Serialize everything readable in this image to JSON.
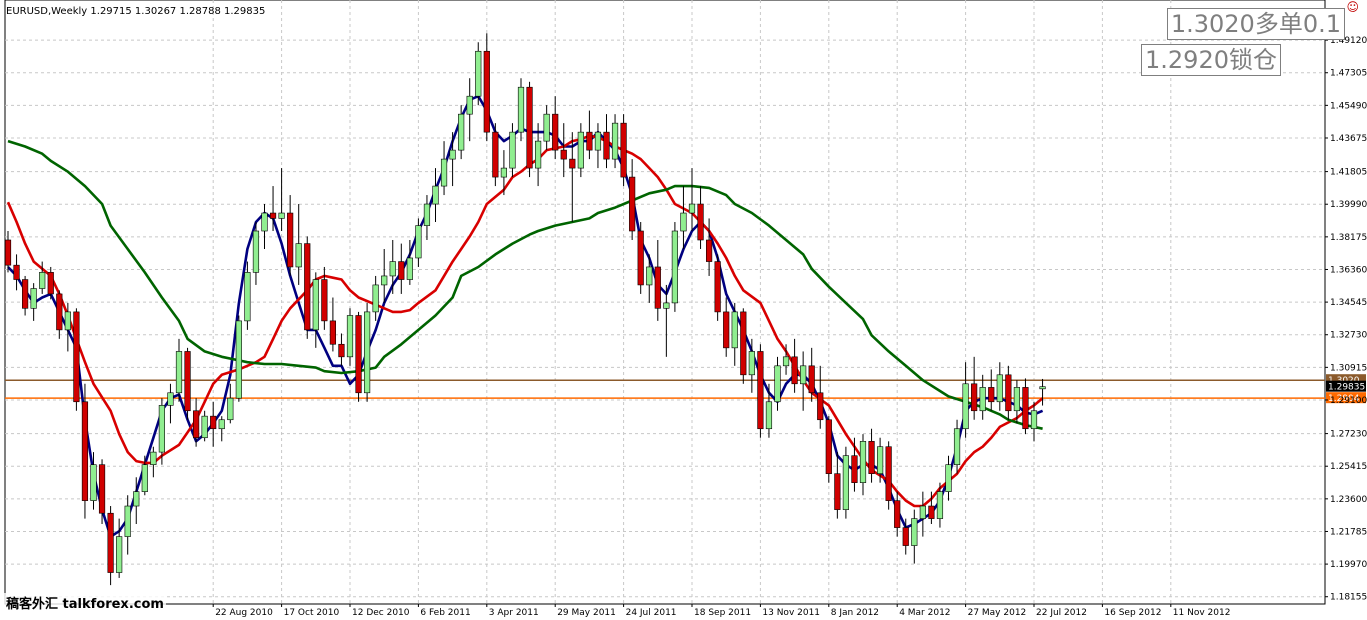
{
  "chart_data": {
    "type": "candlestick",
    "title": "EURUSD,Weekly  1.29715 1.30267 1.28788 1.29835",
    "symbol": "EURUSD",
    "timeframe": "Weekly",
    "ohlc_readout": [
      1.29715,
      1.30267,
      1.28788,
      1.29835
    ],
    "ylim": [
      1.1775,
      1.5035
    ],
    "y_ticks": [
      "1.49120",
      "1.47305",
      "1.45490",
      "1.43675",
      "1.41805",
      "1.39990",
      "1.38175",
      "1.36360",
      "1.34545",
      "1.32730",
      "1.30915",
      "1.29100",
      "1.27230",
      "1.25415",
      "1.23600",
      "1.21785",
      "1.19970",
      "1.18155"
    ],
    "x_tick_labels": [
      "22 Aug 2010",
      "17 Oct 2010",
      "12 Dec 2010",
      "6 Feb 2011",
      "3 Apr 2011",
      "29 May 2011",
      "24 Jul 2011",
      "18 Sep 2011",
      "13 Nov 2011",
      "8 Jan 2012",
      "4 Mar 2012",
      "27 May 2012",
      "22 Jul 2012",
      "16 Sep 2012",
      "11 Nov 2012"
    ],
    "x_tick_index": [
      24,
      32,
      40,
      48,
      56,
      64,
      72,
      80,
      88,
      96,
      104,
      112,
      120,
      128,
      136
    ],
    "grid": true,
    "bull_color": "#90ee90",
    "bear_color": "#d00000",
    "candles": [
      [
        1.38,
        1.385,
        1.362,
        1.366
      ],
      [
        1.366,
        1.372,
        1.352,
        1.358
      ],
      [
        1.358,
        1.36,
        1.338,
        1.342
      ],
      [
        1.342,
        1.356,
        1.335,
        1.353
      ],
      [
        1.353,
        1.368,
        1.35,
        1.362
      ],
      [
        1.362,
        1.365,
        1.347,
        1.35
      ],
      [
        1.35,
        1.352,
        1.325,
        1.33
      ],
      [
        1.33,
        1.345,
        1.318,
        1.34
      ],
      [
        1.34,
        1.342,
        1.285,
        1.29
      ],
      [
        1.29,
        1.3,
        1.225,
        1.235
      ],
      [
        1.235,
        1.262,
        1.23,
        1.255
      ],
      [
        1.255,
        1.258,
        1.222,
        1.228
      ],
      [
        1.228,
        1.232,
        1.188,
        1.195
      ],
      [
        1.195,
        1.225,
        1.192,
        1.215
      ],
      [
        1.215,
        1.238,
        1.205,
        1.232
      ],
      [
        1.232,
        1.248,
        1.222,
        1.24
      ],
      [
        1.24,
        1.26,
        1.238,
        1.255
      ],
      [
        1.255,
        1.265,
        1.248,
        1.262
      ],
      [
        1.262,
        1.292,
        1.255,
        1.288
      ],
      [
        1.288,
        1.3,
        1.278,
        1.295
      ],
      [
        1.295,
        1.325,
        1.29,
        1.318
      ],
      [
        1.318,
        1.32,
        1.28,
        1.285
      ],
      [
        1.285,
        1.292,
        1.265,
        1.27
      ],
      [
        1.27,
        1.285,
        1.268,
        1.282
      ],
      [
        1.282,
        1.29,
        1.265,
        1.275
      ],
      [
        1.275,
        1.282,
        1.268,
        1.28
      ],
      [
        1.28,
        1.3,
        1.278,
        1.292
      ],
      [
        1.292,
        1.338,
        1.29,
        1.335
      ],
      [
        1.335,
        1.368,
        1.33,
        1.362
      ],
      [
        1.362,
        1.39,
        1.355,
        1.385
      ],
      [
        1.385,
        1.4,
        1.375,
        1.395
      ],
      [
        1.395,
        1.41,
        1.385,
        1.392
      ],
      [
        1.392,
        1.42,
        1.385,
        1.395
      ],
      [
        1.395,
        1.405,
        1.36,
        1.365
      ],
      [
        1.365,
        1.4,
        1.355,
        1.378
      ],
      [
        1.378,
        1.382,
        1.325,
        1.33
      ],
      [
        1.33,
        1.362,
        1.32,
        1.358
      ],
      [
        1.358,
        1.365,
        1.33,
        1.335
      ],
      [
        1.335,
        1.348,
        1.318,
        1.322
      ],
      [
        1.322,
        1.328,
        1.31,
        1.315
      ],
      [
        1.315,
        1.342,
        1.31,
        1.338
      ],
      [
        1.338,
        1.34,
        1.29,
        1.295
      ],
      [
        1.295,
        1.345,
        1.29,
        1.34
      ],
      [
        1.34,
        1.36,
        1.335,
        1.355
      ],
      [
        1.355,
        1.375,
        1.345,
        1.36
      ],
      [
        1.36,
        1.38,
        1.35,
        1.368
      ],
      [
        1.368,
        1.378,
        1.35,
        1.358
      ],
      [
        1.358,
        1.38,
        1.355,
        1.37
      ],
      [
        1.37,
        1.392,
        1.365,
        1.388
      ],
      [
        1.388,
        1.405,
        1.38,
        1.4
      ],
      [
        1.4,
        1.42,
        1.39,
        1.41
      ],
      [
        1.41,
        1.435,
        1.405,
        1.425
      ],
      [
        1.425,
        1.44,
        1.41,
        1.43
      ],
      [
        1.43,
        1.455,
        1.425,
        1.45
      ],
      [
        1.45,
        1.47,
        1.435,
        1.46
      ],
      [
        1.46,
        1.49,
        1.455,
        1.485
      ],
      [
        1.485,
        1.495,
        1.435,
        1.44
      ],
      [
        1.44,
        1.445,
        1.41,
        1.415
      ],
      [
        1.415,
        1.43,
        1.405,
        1.42
      ],
      [
        1.42,
        1.445,
        1.415,
        1.44
      ],
      [
        1.44,
        1.47,
        1.435,
        1.465
      ],
      [
        1.465,
        1.468,
        1.415,
        1.42
      ],
      [
        1.42,
        1.445,
        1.41,
        1.435
      ],
      [
        1.435,
        1.455,
        1.43,
        1.45
      ],
      [
        1.45,
        1.46,
        1.425,
        1.43
      ],
      [
        1.43,
        1.445,
        1.415,
        1.425
      ],
      [
        1.425,
        1.44,
        1.39,
        1.42
      ],
      [
        1.42,
        1.445,
        1.415,
        1.44
      ],
      [
        1.44,
        1.452,
        1.425,
        1.43
      ],
      [
        1.43,
        1.445,
        1.42,
        1.44
      ],
      [
        1.44,
        1.45,
        1.42,
        1.425
      ],
      [
        1.425,
        1.45,
        1.42,
        1.445
      ],
      [
        1.445,
        1.45,
        1.41,
        1.415
      ],
      [
        1.415,
        1.425,
        1.38,
        1.385
      ],
      [
        1.385,
        1.39,
        1.35,
        1.355
      ],
      [
        1.355,
        1.372,
        1.345,
        1.365
      ],
      [
        1.365,
        1.38,
        1.335,
        1.342
      ],
      [
        1.342,
        1.355,
        1.315,
        1.345
      ],
      [
        1.345,
        1.39,
        1.34,
        1.385
      ],
      [
        1.385,
        1.41,
        1.375,
        1.395
      ],
      [
        1.395,
        1.42,
        1.385,
        1.4
      ],
      [
        1.4,
        1.41,
        1.375,
        1.38
      ],
      [
        1.38,
        1.392,
        1.36,
        1.368
      ],
      [
        1.368,
        1.372,
        1.335,
        1.34
      ],
      [
        1.34,
        1.348,
        1.315,
        1.32
      ],
      [
        1.32,
        1.345,
        1.31,
        1.34
      ],
      [
        1.34,
        1.342,
        1.3,
        1.305
      ],
      [
        1.305,
        1.325,
        1.295,
        1.318
      ],
      [
        1.318,
        1.322,
        1.27,
        1.275
      ],
      [
        1.275,
        1.3,
        1.27,
        1.29
      ],
      [
        1.29,
        1.315,
        1.285,
        1.31
      ],
      [
        1.31,
        1.322,
        1.305,
        1.315
      ],
      [
        1.315,
        1.325,
        1.295,
        1.3
      ],
      [
        1.3,
        1.318,
        1.285,
        1.31
      ],
      [
        1.31,
        1.32,
        1.29,
        1.295
      ],
      [
        1.295,
        1.31,
        1.275,
        1.28
      ],
      [
        1.28,
        1.282,
        1.245,
        1.25
      ],
      [
        1.25,
        1.262,
        1.225,
        1.23
      ],
      [
        1.23,
        1.265,
        1.225,
        1.26
      ],
      [
        1.26,
        1.27,
        1.24,
        1.245
      ],
      [
        1.245,
        1.272,
        1.238,
        1.268
      ],
      [
        1.268,
        1.275,
        1.245,
        1.25
      ],
      [
        1.25,
        1.27,
        1.245,
        1.265
      ],
      [
        1.265,
        1.268,
        1.23,
        1.235
      ],
      [
        1.235,
        1.24,
        1.215,
        1.22
      ],
      [
        1.22,
        1.225,
        1.205,
        1.21
      ],
      [
        1.21,
        1.23,
        1.2,
        1.225
      ],
      [
        1.225,
        1.24,
        1.215,
        1.232
      ],
      [
        1.232,
        1.24,
        1.222,
        1.225
      ],
      [
        1.225,
        1.245,
        1.22,
        1.24
      ],
      [
        1.24,
        1.26,
        1.235,
        1.255
      ],
      [
        1.255,
        1.28,
        1.25,
        1.275
      ],
      [
        1.275,
        1.312,
        1.27,
        1.3
      ],
      [
        1.3,
        1.315,
        1.28,
        1.285
      ],
      [
        1.285,
        1.305,
        1.28,
        1.298
      ],
      [
        1.298,
        1.308,
        1.285,
        1.29
      ],
      [
        1.29,
        1.312,
        1.285,
        1.305
      ],
      [
        1.305,
        1.31,
        1.28,
        1.285
      ],
      [
        1.285,
        1.302,
        1.278,
        1.298
      ],
      [
        1.298,
        1.303,
        1.272,
        1.275
      ],
      [
        1.275,
        1.29,
        1.268,
        1.285
      ],
      [
        1.2972,
        1.3027,
        1.2879,
        1.2984
      ]
    ],
    "indicators": [
      {
        "color": "#000080",
        "values": [
          1.365,
          1.36,
          1.352,
          1.345,
          1.348,
          1.35,
          1.34,
          1.33,
          1.32,
          1.28,
          1.25,
          1.23,
          1.215,
          1.218,
          1.225,
          1.24,
          1.255,
          1.27,
          1.285,
          1.292,
          1.294,
          1.28,
          1.268,
          1.272,
          1.278,
          1.285,
          1.305,
          1.345,
          1.375,
          1.39,
          1.395,
          1.392,
          1.378,
          1.36,
          1.345,
          1.33,
          1.33,
          1.32,
          1.31,
          1.31,
          1.3,
          1.305,
          1.318,
          1.33,
          1.345,
          1.355,
          1.362,
          1.372,
          1.385,
          1.395,
          1.408,
          1.42,
          1.435,
          1.448,
          1.458,
          1.46,
          1.452,
          1.44,
          1.435,
          1.438,
          1.442,
          1.44,
          1.44,
          1.44,
          1.438,
          1.432,
          1.432,
          1.435,
          1.435,
          1.44,
          1.435,
          1.43,
          1.42,
          1.405,
          1.38,
          1.37,
          1.355,
          1.35,
          1.362,
          1.375,
          1.385,
          1.39,
          1.385,
          1.37,
          1.35,
          1.34,
          1.33,
          1.318,
          1.305,
          1.295,
          1.29,
          1.3,
          1.305,
          1.305,
          1.3,
          1.29,
          1.278,
          1.26,
          1.255,
          1.252,
          1.255,
          1.255,
          1.252,
          1.242,
          1.23,
          1.22,
          1.222,
          1.225,
          1.228,
          1.235,
          1.248,
          1.265,
          1.285,
          1.29,
          1.292,
          1.292,
          1.292,
          1.29,
          1.288,
          1.284,
          1.283,
          1.285
        ]
      },
      {
        "color": "#d80000",
        "values": [
          1.401,
          1.39,
          1.378,
          1.368,
          1.36,
          1.35,
          1.338,
          1.325,
          1.312,
          1.3,
          1.285,
          1.272,
          1.262,
          1.257,
          1.256,
          1.256,
          1.26,
          1.266,
          1.273,
          1.28,
          1.29,
          1.3,
          1.305,
          1.308,
          1.31,
          1.312,
          1.315,
          1.325,
          1.335,
          1.342,
          1.352,
          1.358,
          1.36,
          1.359,
          1.358,
          1.352,
          1.348,
          1.344,
          1.342,
          1.34,
          1.34,
          1.341,
          1.345,
          1.352,
          1.36,
          1.368,
          1.375,
          1.382,
          1.39,
          1.4,
          1.408,
          1.415,
          1.418,
          1.422,
          1.425,
          1.43,
          1.432,
          1.435,
          1.436,
          1.438,
          1.437,
          1.435,
          1.432,
          1.428,
          1.425,
          1.42,
          1.415,
          1.408,
          1.4,
          1.395,
          1.39,
          1.385,
          1.378,
          1.37,
          1.36,
          1.352,
          1.345,
          1.335,
          1.325,
          1.318,
          1.31,
          1.302,
          1.295,
          1.288,
          1.28,
          1.272,
          1.265,
          1.258,
          1.252,
          1.246,
          1.24,
          1.235,
          1.232,
          1.232,
          1.236,
          1.242,
          1.25,
          1.257,
          1.262,
          1.265,
          1.27,
          1.276,
          1.281,
          1.285,
          1.288,
          1.292
        ]
      },
      {
        "color": "#006400",
        "values": [
          1.435,
          1.432,
          1.428,
          1.424,
          1.418,
          1.41,
          1.4,
          1.388,
          1.375,
          1.362,
          1.348,
          1.335,
          1.325,
          1.318,
          1.315,
          1.313,
          1.312,
          1.311,
          1.311,
          1.31,
          1.309,
          1.307,
          1.306,
          1.307,
          1.309,
          1.315,
          1.322,
          1.33,
          1.338,
          1.348,
          1.36,
          1.365,
          1.372,
          1.378,
          1.383,
          1.385,
          1.388,
          1.39,
          1.392,
          1.395,
          1.398,
          1.402,
          1.406,
          1.408,
          1.41,
          1.41,
          1.409,
          1.405,
          1.4,
          1.395,
          1.388,
          1.38,
          1.372,
          1.364,
          1.354,
          1.345,
          1.336,
          1.327,
          1.318,
          1.31,
          1.302,
          1.296,
          1.293,
          1.29,
          1.287,
          1.283,
          1.28,
          1.277,
          1.275
        ]
      }
    ],
    "horizontal_lines": [
      {
        "value": 1.302,
        "color": "#8b5a2b",
        "label": "1.3020"
      },
      {
        "value": 1.292,
        "color": "#ff6a00",
        "label": "1.2904"
      }
    ],
    "current_price_label": "1.29835"
  },
  "annotations": {
    "line1": "1.3020多单0.1",
    "line2": "1.2920锁仓"
  },
  "watermark": "稿客外汇 talkforex.com"
}
